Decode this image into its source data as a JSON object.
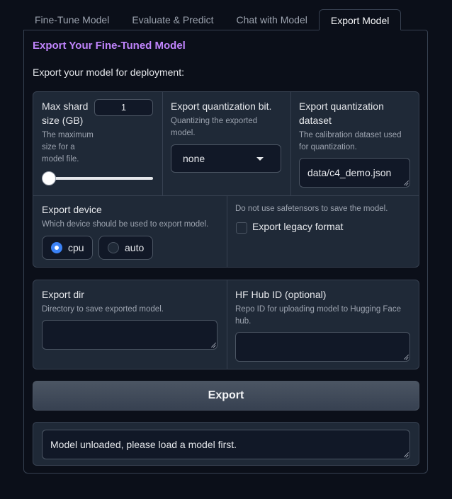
{
  "tabs": [
    "Fine-Tune Model",
    "Evaluate & Predict",
    "Chat with Model",
    "Export Model"
  ],
  "active_tab": "Export Model",
  "title": "Export Your Fine-Tuned Model",
  "subtitle": "Export your model for deployment:",
  "shard": {
    "label_line1": "Max shard",
    "label_line2": "size (GB)",
    "value": "1",
    "info_lines": [
      "The maximum",
      "size for a",
      "model file."
    ],
    "slider_fraction": 0
  },
  "quant_bit": {
    "label": "Export quantization bit.",
    "info_lines": [
      "Quantizing the exported",
      "model."
    ],
    "value": "none"
  },
  "quant_dataset": {
    "label_line1": "Export quantization",
    "label_line2": "dataset",
    "info_lines": [
      "The calibration dataset used",
      "for quantization."
    ],
    "value": "data/c4_demo.json"
  },
  "device": {
    "label": "Export device",
    "info": "Which device should be used to export model.",
    "options": [
      "cpu",
      "auto"
    ],
    "selected": "cpu"
  },
  "legacy": {
    "info": "Do not use safetensors to save the model.",
    "label": "Export legacy format",
    "checked": false
  },
  "export_dir": {
    "label": "Export dir",
    "info": "Directory to save exported model.",
    "value": ""
  },
  "hub_id": {
    "label": "HF Hub ID (optional)",
    "info_lines": [
      "Repo ID for uploading model to Hugging Face",
      "hub."
    ],
    "value": ""
  },
  "export_button": "Export",
  "output": "Model unloaded, please load a model first.",
  "colors": {
    "accent": "#c084fc",
    "radio": "#3b82f6",
    "panel": "#1f2937",
    "background": "#0b0f19"
  },
  "icons": {
    "select_caret": "caret-down-icon",
    "resize_grip": "resize-grip-icon"
  }
}
